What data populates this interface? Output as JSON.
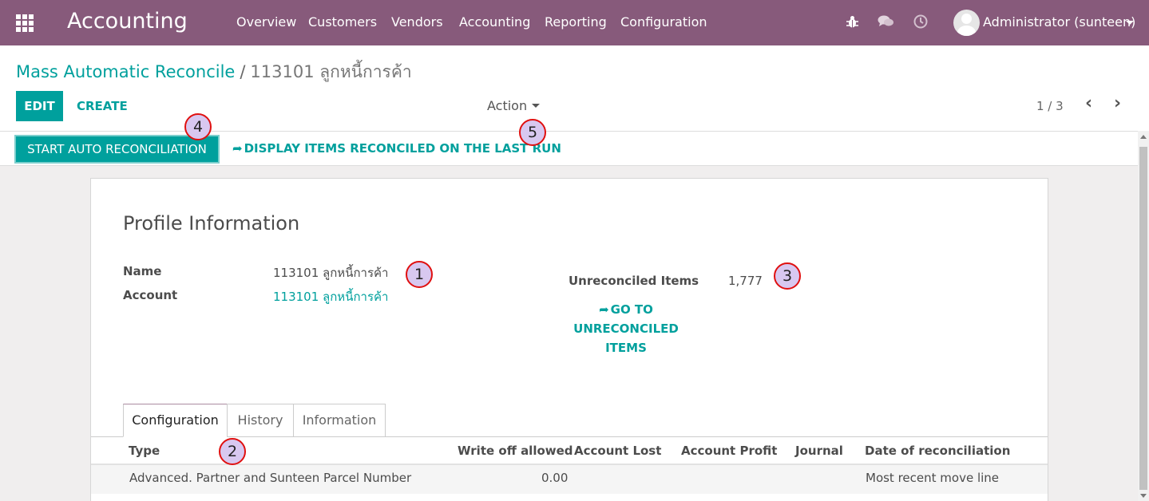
{
  "navbar": {
    "brand": "Accounting",
    "menu": [
      "Overview",
      "Customers",
      "Vendors",
      "Accounting",
      "Reporting",
      "Configuration"
    ],
    "icons": [
      "bug-icon",
      "chat-icon",
      "clock-icon"
    ],
    "user": "Administrator (sunteen)"
  },
  "breadcrumb": {
    "parent": "Mass Automatic Reconcile",
    "separator": "/",
    "current": "113101 ลูกหนี้การค้า"
  },
  "toolbar": {
    "edit_label": "EDIT",
    "create_label": "CREATE",
    "action_label": "Action",
    "pager": "1 / 3"
  },
  "statusbar": {
    "start_label": "START AUTO RECONCILIATION",
    "display_label": "DISPLAY ITEMS RECONCILED ON THE LAST RUN"
  },
  "form": {
    "title": "Profile Information",
    "name_label": "Name",
    "name_value": "113101 ลูกหนี้การค้า",
    "account_label": "Account",
    "account_value": "113101 ลูกหนี้การค้า",
    "unreconciled_label": "Unreconciled Items",
    "unreconciled_value": "1,777",
    "goto_line1": "GO TO",
    "goto_line2": "UNRECONCILED",
    "goto_line3": "ITEMS"
  },
  "tabs": [
    "Configuration",
    "History",
    "Information"
  ],
  "table": {
    "headers": [
      "Type",
      "Write off allowed",
      "Account Lost",
      "Account Profit",
      "Journal",
      "Date of reconciliation"
    ],
    "rows": [
      [
        "Advanced. Partner and Sunteen Parcel Number",
        "0.00",
        "",
        "",
        "",
        "Most recent move line"
      ]
    ]
  },
  "markers": [
    "1",
    "2",
    "3",
    "4",
    "5"
  ],
  "colors": {
    "navbar": "#875a7b",
    "primary": "#00a09d",
    "marker_border": "#e01010",
    "marker_fill": "#d8c8f0"
  }
}
